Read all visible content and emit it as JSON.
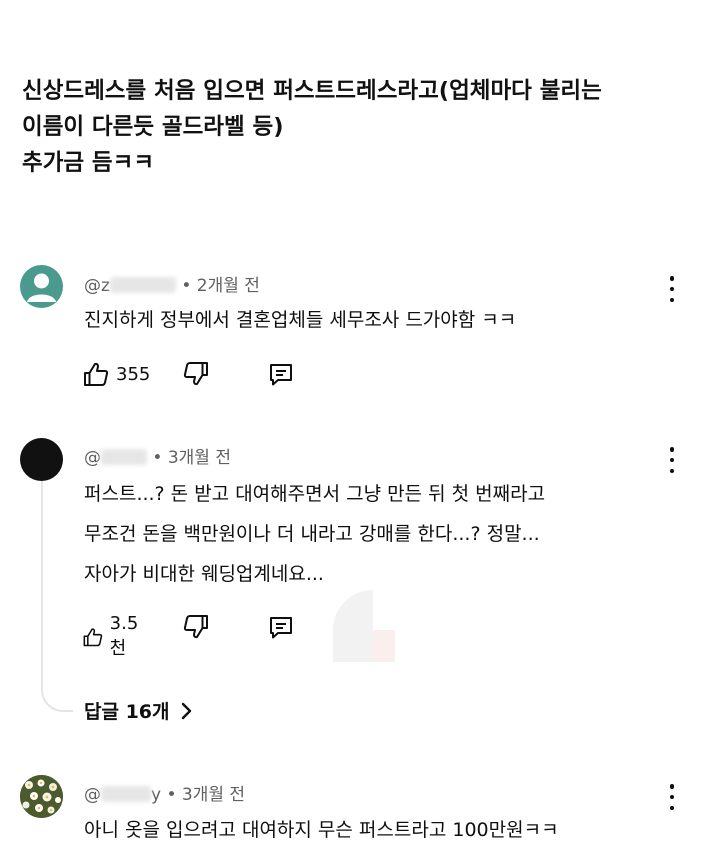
{
  "post": {
    "lines": [
      "신상드레스를 처음 입으면 퍼스트드레스라고(업체마다 불리는",
      "이름이 다른듯 골드라벨 등)",
      "추가금 듬ㅋㅋ"
    ]
  },
  "comments": [
    {
      "handle": "@z",
      "time": " • 2개월 전",
      "lines": [
        "진지하게 정부에서 결혼업체들 세무조사 드가야함 ㅋㅋ"
      ],
      "likes": "355"
    },
    {
      "handle": "@",
      "time": " • 3개월 전",
      "lines": [
        "퍼스트...? 돈 받고 대여해주면서 그냥 만든 뒤 첫 번째라고",
        "무조건 돈을 백만원이나 더 내라고 강매를 한다...? 정말...",
        "자아가 비대한 웨딩업계네요..."
      ],
      "likes": "3.5천",
      "replies_label": "답글 16개"
    },
    {
      "handle": "@",
      "handle_tail": "y",
      "time": " • 3개월 전",
      "lines": [
        "아니 옷을 입으려고 대여하지 무슨 퍼스트라고 100만원ㅋㅋ"
      ]
    }
  ],
  "colors": {
    "text": "#0f0f0f",
    "meta": "#606060",
    "avatar1": "#4a9a8e",
    "avatar2": "#111111"
  },
  "icons": [
    "like-icon",
    "dislike-icon",
    "reply-icon",
    "more-vert-icon",
    "chevron-right-icon",
    "account-icon"
  ]
}
